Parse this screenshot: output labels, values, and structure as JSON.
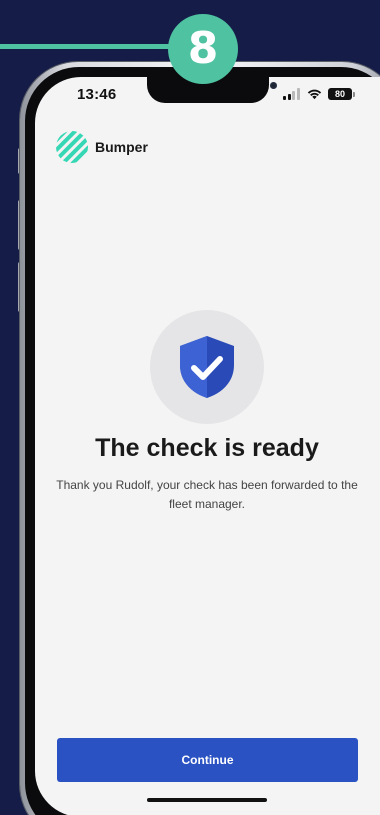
{
  "step": {
    "number": "8"
  },
  "status_bar": {
    "time": "13:46",
    "battery": "80",
    "icons": [
      "signal-icon",
      "wifi-icon",
      "battery-icon"
    ]
  },
  "brand": {
    "name": "Bumper",
    "icon": "bumper-logo-icon"
  },
  "confirmation": {
    "icon": "shield-check-icon",
    "title": "The check is ready",
    "message": "Thank you Rudolf, your check has been forwarded to the fleet manager."
  },
  "actions": {
    "continue_label": "Continue"
  },
  "colors": {
    "background": "#141c47",
    "step_accent": "#4fc2a2",
    "logo": "#35d7b5",
    "primary_button": "#2a52c3",
    "shield": "#2a4ab8",
    "screen": "#f4f4f4",
    "title_text": "#1a1a1a"
  }
}
